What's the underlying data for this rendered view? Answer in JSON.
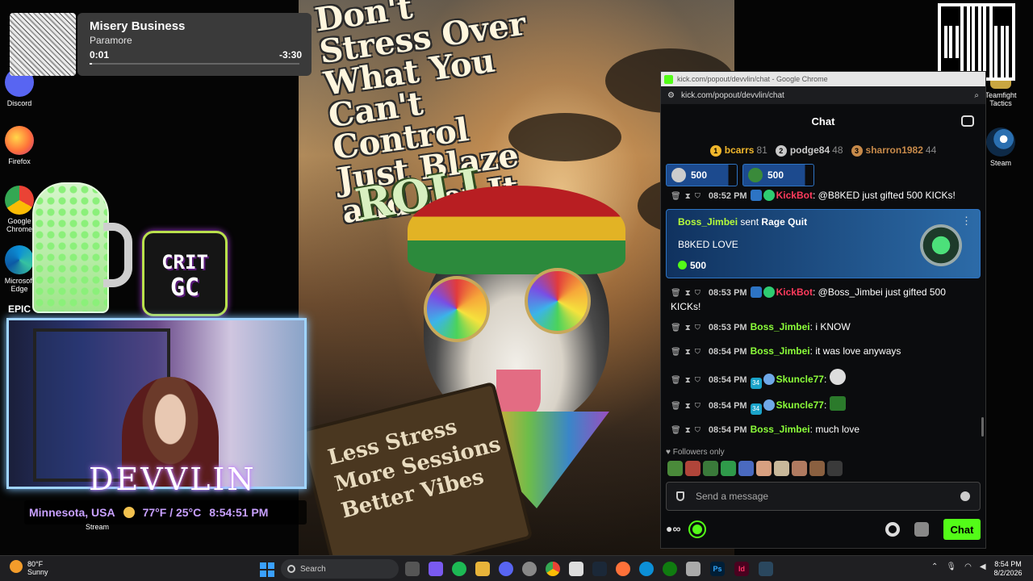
{
  "desktop": {
    "icons": [
      {
        "label": "Discord",
        "color": "#5865f2"
      },
      {
        "label": "Firefox",
        "color": "#ff7139"
      },
      {
        "label": "Google Chrome",
        "color": "#4285f4"
      },
      {
        "label": "Microsoft Edge",
        "color": "#0c8fd6"
      },
      {
        "label": "EPIC",
        "color": "#2a2a2a"
      },
      {
        "label": "Teamfight Tactics",
        "color": "#c9a640"
      },
      {
        "label": "Steam",
        "color": "#1b2838"
      },
      {
        "label": "Stream",
        "color": "#333333"
      }
    ]
  },
  "media": {
    "title": "Misery Business",
    "artist": "Paramore",
    "elapsed": "0:01",
    "remaining": "-3:30",
    "progress": 0.005
  },
  "poster": {
    "headline": "Don't Stress Over What You Can't Control Just Blaze and Let It",
    "roll": "ROLL",
    "sign": "Less Stress More Sessions Better Vibes"
  },
  "overlay": {
    "logo_line1": "CRIT",
    "logo_line2": "GC",
    "brand": "DEVVLIN",
    "location": "Minnesota, USA",
    "temperature": "77°F / 25°C",
    "time": "8:54:51 PM"
  },
  "browser": {
    "title": "kick.com/popout/devvlin/chat - Google Chrome",
    "url": "kick.com/popout/devvlin/chat"
  },
  "chat": {
    "header": "Chat",
    "leaderboard": [
      {
        "rank": "1",
        "name": "bcarrs",
        "count": "81",
        "color": "#f1b72c"
      },
      {
        "rank": "2",
        "name": "podge84",
        "count": "48",
        "color": "#c9c9c9"
      },
      {
        "rank": "3",
        "name": "sharron1982",
        "count": "44",
        "color": "#c78a4a"
      }
    ],
    "gifts": [
      {
        "amount": "500"
      },
      {
        "amount": "500"
      }
    ],
    "messages": [
      {
        "time": "08:52 PM",
        "user": "KickBot",
        "sep": ":",
        "text": " @B8KED just gifted 500 KICKs!",
        "color": "#ff3b5c"
      },
      {
        "time": "08:53 PM",
        "user": "KickBot",
        "sep": ":",
        "text": " @Boss_Jimbei just gifted 500 KICKs!",
        "color": "#ff3b5c"
      },
      {
        "time": "08:53 PM",
        "user": "Boss_Jimbei",
        "sep": ":",
        "text": " i KNOW",
        "color": "#8cff3a"
      },
      {
        "time": "08:54 PM",
        "user": "Boss_Jimbei",
        "sep": ":",
        "text": " it was love anyways",
        "color": "#8cff3a"
      },
      {
        "time": "08:54 PM",
        "user": "Skuncle77",
        "sep": ":",
        "text": "",
        "color": "#8cff3a",
        "sub": "34"
      },
      {
        "time": "08:54 PM",
        "user": "Skuncle77",
        "sep": ":",
        "text": "",
        "color": "#8cff3a",
        "sub": "34"
      },
      {
        "time": "08:54 PM",
        "user": "Boss_Jimbei",
        "sep": ":",
        "text": " much love",
        "color": "#8cff3a"
      }
    ],
    "giftcard": {
      "user": "Boss_Jimbei",
      "action": " sent ",
      "item": "Rage Quit",
      "message": "B8KED LOVE",
      "amount": "500"
    },
    "followers_only": "Followers only",
    "input_placeholder": "Send a message",
    "send_button": "Chat"
  },
  "taskbar": {
    "weather_temp": "80°F",
    "weather_desc": "Sunny",
    "search_placeholder": "Search",
    "clock_time": "8:54 PM",
    "clock_date": "8/2/2026"
  }
}
